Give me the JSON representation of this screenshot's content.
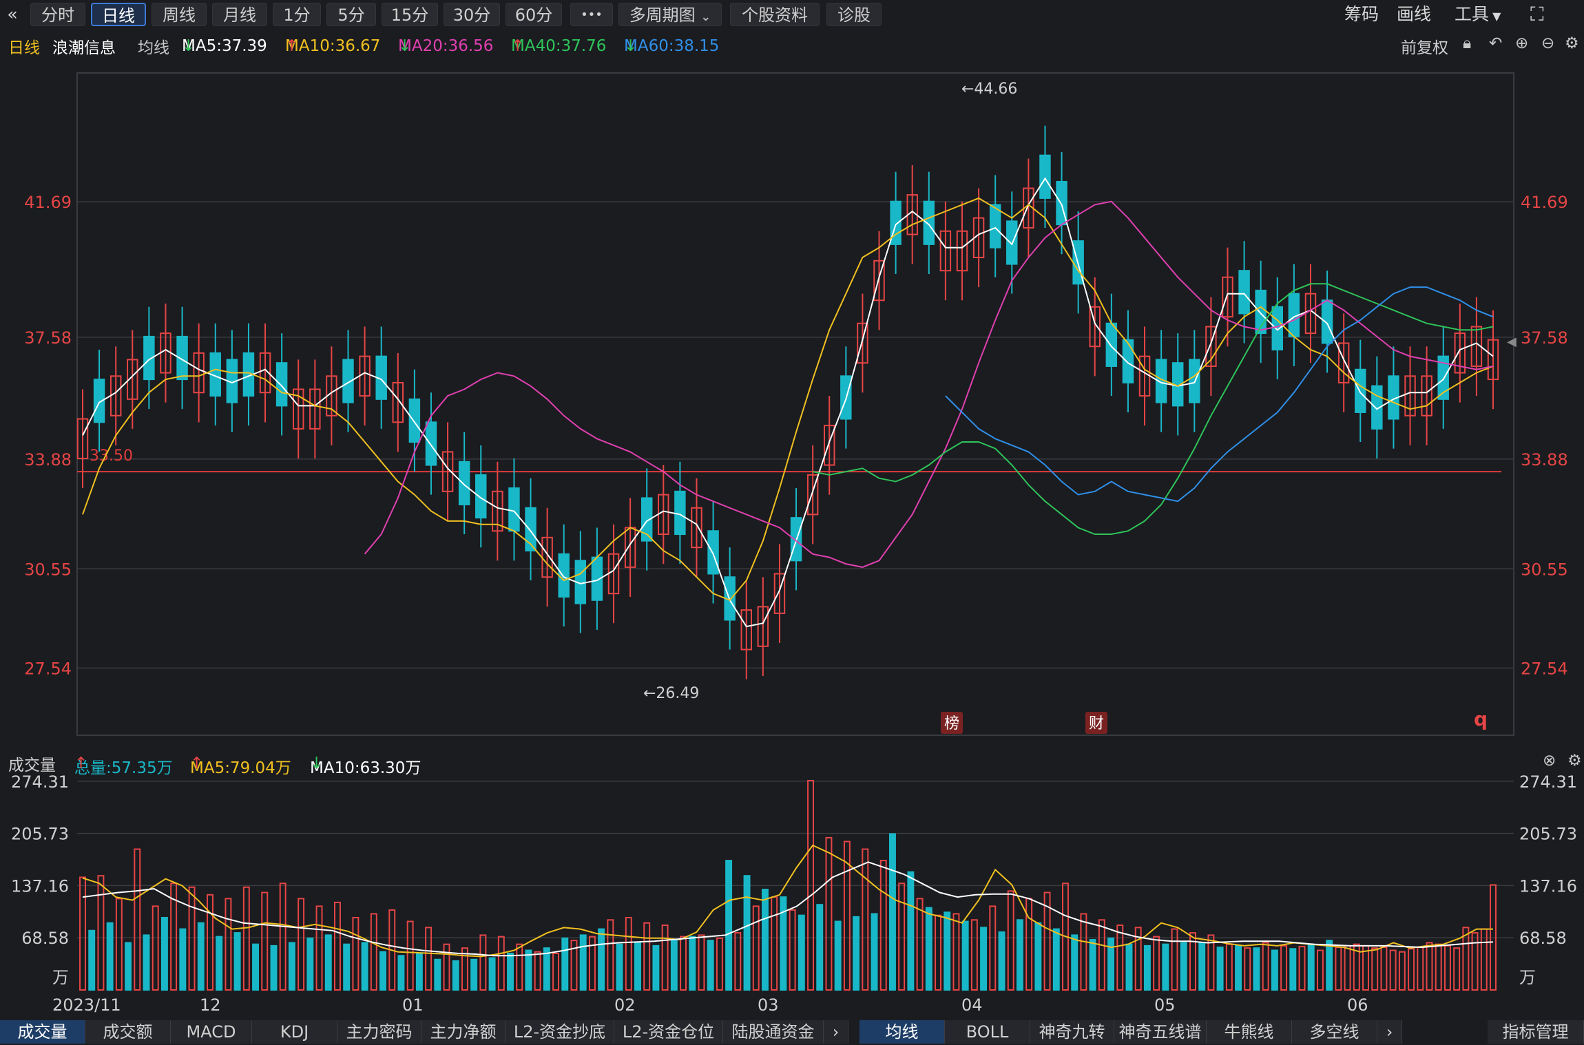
{
  "toolbar": {
    "back_icon": "double-chevron-left-icon",
    "periods": [
      "分时",
      "日线",
      "周线",
      "月线",
      "1分",
      "5分",
      "15分",
      "30分",
      "60分"
    ],
    "active_period": "日线",
    "more": "•••",
    "multi_period": "多周期图",
    "stock_info": "个股资料",
    "diagnose": "诊股",
    "chips": "筹码",
    "draw": "画线",
    "tools": "工具",
    "fullscreen_icon": "fullscreen-icon"
  },
  "legend": {
    "period": "日线",
    "stock_name": "浪潮信息",
    "ma_label": "均线",
    "ma5": "MA5:37.39",
    "ma10": "MA10:36.67",
    "ma20": "MA20:36.56",
    "ma40": "MA40:37.76",
    "ma60": "MA60:38.15",
    "adjust": "前复权",
    "icons": [
      "lock-icon",
      "undo-icon",
      "zoom-in-icon",
      "zoom-out-icon",
      "settings-icon"
    ]
  },
  "colors": {
    "up": "#e64545",
    "down": "#19b8c8",
    "ma5": "#ffffff",
    "ma10": "#f0c020",
    "ma20": "#e040b0",
    "ma40": "#2ec45a",
    "ma60": "#2f8fe8",
    "axis_label": "#e64545",
    "grid": "#3a3b40",
    "cost_line": "#e03c3c"
  },
  "chart_data": [
    {
      "type": "candlestick",
      "title": "浪潮信息 日线",
      "ylim": [
        25.5,
        45.6
      ],
      "y_ticks": [
        "41.69",
        "37.58",
        "33.88",
        "30.55",
        "27.54"
      ],
      "y_tick_values": [
        41.69,
        37.58,
        33.88,
        30.55,
        27.54
      ],
      "annotations": {
        "high": "←44.66",
        "low": "←26.49",
        "cost_line_label": "33.50",
        "cost_line_value": 33.5
      },
      "markers": [
        "榜",
        "财",
        "q"
      ],
      "series": [
        {
          "name": "MA5",
          "values": [
            34.6,
            35.6,
            35.9,
            36.4,
            36.9,
            37.2,
            36.9,
            36.6,
            36.4,
            36.2,
            36.4,
            36.6,
            36.1,
            35.5,
            35.5,
            35.9,
            36.2,
            36.5,
            36.3,
            35.7,
            35.0,
            34.3,
            33.6,
            33.1,
            32.7,
            32.4,
            32.3,
            31.7,
            31.0,
            30.3,
            30.1,
            30.2,
            30.5,
            31.3,
            32.0,
            32.3,
            32.2,
            31.9,
            31.0,
            29.6,
            28.8,
            28.9,
            29.9,
            31.4,
            32.9,
            34.4,
            35.7,
            37.5,
            39.4,
            41.0,
            41.4,
            41.0,
            40.3,
            40.3,
            40.7,
            40.9,
            40.4,
            41.6,
            42.4,
            41.6,
            39.8,
            38.0,
            37.3,
            36.8,
            36.5,
            36.2,
            36.1,
            36.2,
            37.4,
            38.9,
            38.9,
            38.3,
            37.8,
            38.2,
            38.4,
            38.0,
            36.9,
            35.9,
            35.4,
            35.7,
            35.9,
            35.9,
            36.3,
            37.2,
            37.4,
            37.0
          ]
        },
        {
          "name": "MA10",
          "values": [
            32.2,
            33.6,
            34.6,
            35.3,
            35.9,
            36.3,
            36.4,
            36.4,
            36.6,
            36.5,
            36.5,
            36.3,
            35.9,
            35.8,
            35.5,
            35.4,
            35.0,
            34.4,
            33.8,
            33.2,
            32.8,
            32.3,
            32.0,
            32.0,
            31.9,
            31.9,
            31.7,
            31.3,
            30.7,
            30.2,
            30.4,
            30.9,
            31.4,
            31.8,
            31.6,
            31.1,
            30.8,
            30.3,
            29.8,
            29.6,
            30.2,
            31.4,
            33.0,
            34.7,
            36.3,
            37.8,
            38.9,
            40.0,
            40.3,
            40.7,
            41.0,
            41.2,
            41.4,
            41.6,
            41.8,
            41.5,
            41.2,
            41.6,
            41.2,
            40.4,
            39.6,
            39.0,
            38.0,
            37.4,
            36.6,
            36.3,
            36.1,
            36.4,
            36.9,
            37.7,
            38.2,
            38.5,
            38.1,
            37.6,
            37.2,
            37.0,
            36.5,
            36.1,
            35.8,
            35.6,
            35.4,
            35.5,
            35.9,
            36.2,
            36.5,
            36.7
          ]
        },
        {
          "name": "MA20",
          "values": [
            31.0,
            31.6,
            32.7,
            34.1,
            35.2,
            35.8,
            36.0,
            36.3,
            36.5,
            36.4,
            36.1,
            35.7,
            35.2,
            34.8,
            34.5,
            34.3,
            34.1,
            33.8,
            33.5,
            33.1,
            32.8,
            32.6,
            32.4,
            32.2,
            32.0,
            31.8,
            31.4,
            31.0,
            30.9,
            30.7,
            30.6,
            30.8,
            31.5,
            32.2,
            33.2,
            34.2,
            35.4,
            36.8,
            38.1,
            39.3,
            40.0,
            40.6,
            41.0,
            41.3,
            41.6,
            41.7,
            41.2,
            40.6,
            40.0,
            39.4,
            38.9,
            38.4,
            38.1,
            37.9,
            37.8,
            37.9,
            38.1,
            38.4,
            38.7,
            38.4,
            38.0,
            37.6,
            37.2,
            37.0,
            36.9,
            36.8,
            36.7,
            36.6,
            36.7
          ]
        },
        {
          "name": "MA40",
          "values": [
            33.5,
            33.4,
            33.5,
            33.6,
            33.3,
            33.2,
            33.4,
            33.7,
            34.1,
            34.4,
            34.4,
            34.2,
            33.7,
            33.1,
            32.6,
            32.2,
            31.8,
            31.6,
            31.6,
            31.7,
            32.0,
            32.5,
            33.3,
            34.2,
            35.2,
            36.1,
            37.0,
            37.9,
            38.6,
            39.0,
            39.2,
            39.2,
            39.0,
            38.8,
            38.6,
            38.4,
            38.2,
            38.0,
            37.9,
            37.8,
            37.8,
            37.9
          ]
        },
        {
          "name": "MA60",
          "values": [
            35.8,
            35.3,
            34.8,
            34.5,
            34.3,
            34.1,
            33.7,
            33.2,
            32.8,
            32.9,
            33.2,
            32.9,
            32.8,
            32.7,
            32.6,
            33.0,
            33.6,
            34.1,
            34.5,
            34.9,
            35.3,
            35.9,
            36.6,
            37.3,
            37.8,
            38.1,
            38.5,
            38.9,
            39.1,
            39.1,
            38.9,
            38.7,
            38.4,
            38.2
          ]
        }
      ]
    },
    {
      "type": "bar",
      "title": "成交量",
      "unit": "万",
      "ylim": [
        0,
        275
      ],
      "y_ticks": [
        "274.31",
        "205.73",
        "137.16",
        "68.58"
      ],
      "y_tick_values": [
        274.31,
        205.73,
        137.16,
        68.58
      ],
      "total": "总量:57.35万",
      "ma5": "MA5:79.04万",
      "ma10": "MA10:63.30万",
      "x_ticks": [
        "2023/11",
        "12",
        "01",
        "02",
        "03",
        "04",
        "05",
        "06"
      ],
      "series": [
        {
          "name": "MA5",
          "values": [
            147,
            140,
            122,
            118,
            132,
            146,
            137,
            117,
            94,
            80,
            82,
            88,
            86,
            82,
            86,
            82,
            77,
            67,
            56,
            50,
            49,
            48,
            47,
            45,
            44,
            47,
            52,
            64,
            75,
            82,
            80,
            74,
            72,
            70,
            68,
            68,
            66,
            76,
            105,
            118,
            122,
            118,
            125,
            160,
            190,
            180,
            168,
            150,
            132,
            118,
            110,
            100,
            95,
            88,
            118,
            158,
            138,
            95,
            82,
            72,
            65,
            61,
            56,
            60,
            70,
            88,
            82,
            68,
            65,
            61,
            58,
            60,
            58,
            62,
            60,
            58,
            56,
            50,
            53,
            62,
            55,
            58,
            60,
            68,
            80,
            80
          ]
        },
        {
          "name": "MA10",
          "values": [
            122,
            125,
            128,
            130,
            133,
            120,
            110,
            102,
            94,
            88,
            86,
            84,
            82,
            80,
            78,
            70,
            64,
            59,
            55,
            52,
            50,
            48,
            47,
            45,
            45,
            46,
            48,
            52,
            57,
            60,
            62,
            63,
            64,
            66,
            68,
            70,
            72,
            82,
            92,
            100,
            110,
            128,
            148,
            158,
            168,
            160,
            152,
            140,
            128,
            122,
            125,
            126,
            126,
            120,
            110,
            98,
            90,
            84,
            76,
            70,
            66,
            64,
            64,
            62,
            63,
            64,
            64,
            64,
            62,
            60,
            59,
            58,
            58,
            58,
            57,
            56,
            58,
            60,
            62,
            63
          ]
        }
      ],
      "volumes_up": [
        148,
        150,
        120,
        185,
        110,
        140,
        135,
        125,
        120,
        135,
        128,
        140,
        120,
        110,
        115,
        95,
        100,
        105,
        90,
        82,
        60,
        55,
        72,
        70,
        60,
        50,
        48,
        65,
        70,
        92,
        95,
        88,
        85,
        70,
        72,
        68,
        75,
        110,
        122,
        105,
        275,
        200,
        195,
        185,
        170,
        140,
        120,
        98,
        100,
        92,
        110,
        130,
        120,
        128,
        140,
        100,
        92,
        85,
        82,
        70,
        80,
        75,
        72,
        60,
        55,
        62,
        58,
        57,
        52,
        56,
        58,
        60,
        58,
        55,
        56,
        52,
        50,
        54,
        56,
        62,
        60,
        58,
        55,
        82,
        75,
        80,
        138
      ]
    },
    {
      "type": "table",
      "title": "volumes_down",
      "values": [
        78,
        88,
        62,
        72,
        95,
        80,
        88,
        70,
        75,
        60,
        58,
        62,
        68,
        72,
        60,
        62,
        50,
        45,
        48,
        40,
        38,
        40,
        42,
        48,
        52,
        55,
        68,
        72,
        80,
        60,
        62,
        58,
        66,
        70,
        65,
        170,
        150,
        132,
        122,
        98,
        112,
        90,
        96,
        100,
        205,
        155,
        108,
        102,
        90,
        82,
        76,
        92,
        88,
        80,
        72,
        66,
        68,
        60,
        58,
        60,
        62,
        62,
        56,
        58,
        55,
        52,
        54,
        60,
        65
      ]
    }
  ],
  "bottom_tabs_left": [
    "成交量",
    "成交额",
    "MACD",
    "KDJ",
    "主力密码",
    "主力净额",
    "L2-资金抄底",
    "L2-资金仓位",
    "陆股通资金"
  ],
  "bottom_tabs_left_active": "成交量",
  "bottom_tabs_right": [
    "均线",
    "BOLL",
    "神奇九转",
    "神奇五线谱",
    "牛熊线",
    "多空线"
  ],
  "bottom_tabs_right_active": "均线",
  "indicator_manage": "指标管理",
  "vol_panel_icons": [
    "close-icon",
    "settings-icon"
  ]
}
